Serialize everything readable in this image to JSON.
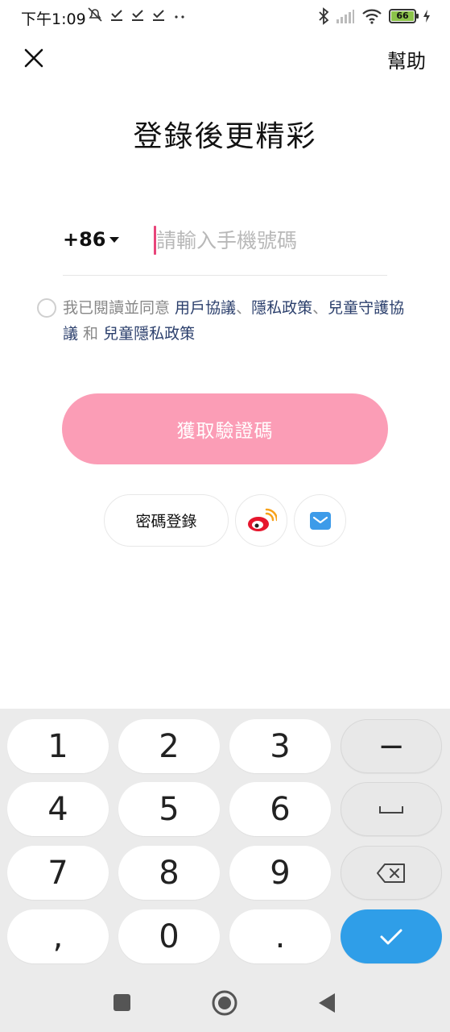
{
  "status_bar": {
    "time": "下午1:09",
    "battery": "66"
  },
  "header": {
    "help_label": "幫助",
    "title": "登錄後更精彩"
  },
  "phone": {
    "country_code": "+86",
    "placeholder": "請輸入手機號碼",
    "value": ""
  },
  "agreement": {
    "prefix": "我已閱讀並同意 ",
    "user_agreement": "用戶協議",
    "sep1": "、",
    "privacy_policy": "隱私政策",
    "sep2": "、",
    "child_protection": "兒童守護協議",
    "conj": " 和 ",
    "child_privacy": "兒童隱私政策"
  },
  "actions": {
    "get_code_label": "獲取驗證碼",
    "password_login_label": "密碼登錄"
  },
  "keyboard": {
    "keys": [
      "1",
      "2",
      "3",
      "4",
      "5",
      "6",
      "7",
      "8",
      "9",
      ",",
      "0",
      "."
    ],
    "minus": "−"
  },
  "colors": {
    "accent_pink": "#fb9db6",
    "cursor": "#e8457a",
    "link": "#2b3f6c",
    "done_key": "#2f9ee8"
  }
}
